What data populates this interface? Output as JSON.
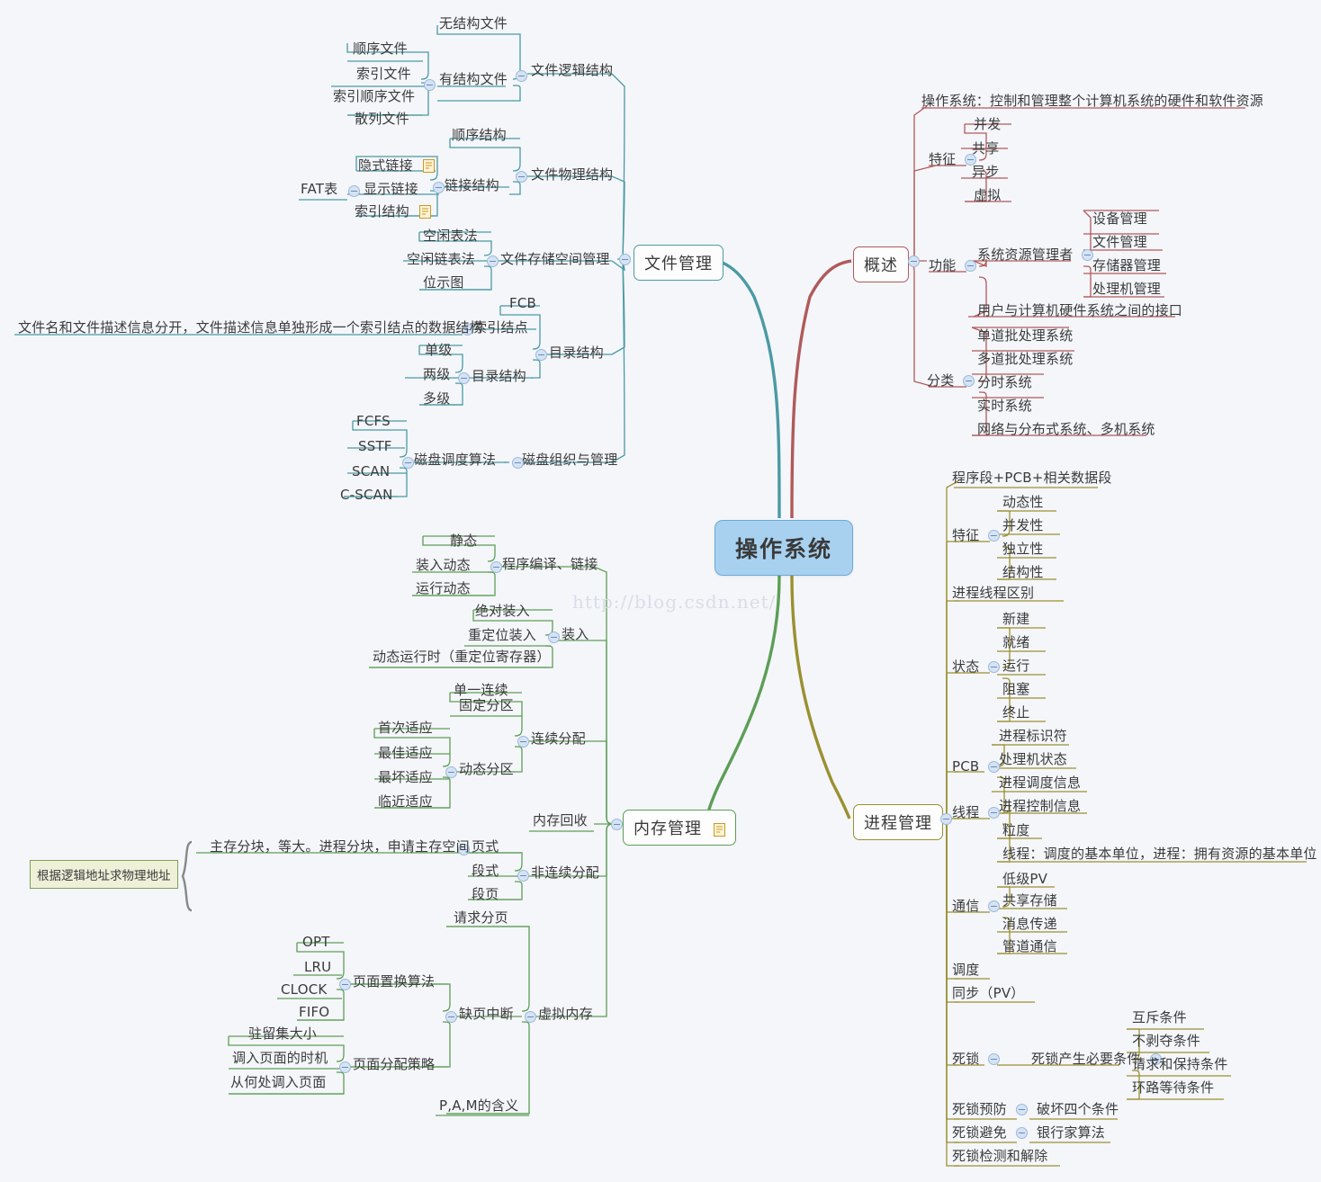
{
  "root": {
    "label": "操作系统"
  },
  "watermark": "http://blog.csdn.net/",
  "colors": {
    "file_branch": "#4a9aa3",
    "overview_branch": "#b05a5a",
    "memory_branch": "#5d9e56",
    "process_branch": "#9a9030",
    "root_fill": "#a8d1f0",
    "root_border": "#6fa8d4",
    "background": "#f4f6fa",
    "callout_fill": "#eef0d8",
    "callout_border": "#7fa05a"
  },
  "main_topics": {
    "file": "文件管理",
    "overview": "概述",
    "memory": "内存管理",
    "process": "进程管理"
  },
  "overview": {
    "definition": "操作系统：控制和管理整个计算机系统的硬件和软件资源",
    "features_label": "特征",
    "features": [
      "并发",
      "共享",
      "异步",
      "虚拟"
    ],
    "functions_label": "功能",
    "resource_manager": "系统资源管理者",
    "resource_items": [
      "设备管理",
      "文件管理",
      "存储器管理",
      "处理机管理"
    ],
    "interface": "用户与计算机硬件系统之间的接口",
    "classification_label": "分类",
    "classification": [
      "单道批处理系统",
      "多道批处理系统",
      "分时系统",
      "实时系统",
      "网络与分布式系统、多机系统"
    ]
  },
  "file": {
    "logical_structure": "文件逻辑结构",
    "unstructured": "无结构文件",
    "structured": "有结构文件",
    "structured_items": [
      "顺序文件",
      "索引文件",
      "索引顺序文件",
      "散列文件"
    ],
    "physical_structure": "文件物理结构",
    "sequential_struct": "顺序结构",
    "link_struct": "链接结构",
    "link_items": [
      "隐式链接",
      "显示链接",
      "索引结构"
    ],
    "fat": "FAT表",
    "storage_mgmt": "文件存储空间管理",
    "storage_items": [
      "空闲表法",
      "空闲链表法",
      "位示图"
    ],
    "directory_structure": "目录结构",
    "fcb": "FCB",
    "index_node": "索引结点",
    "index_node_note": "文件名和文件描述信息分开，文件描述信息单独形成一个索引结点的数据结构",
    "dir_structure_sub": "目录结构",
    "dir_levels": [
      "单级",
      "两级",
      "多级"
    ],
    "disk_mgmt": "磁盘组织与管理",
    "disk_sched": "磁盘调度算法",
    "disk_algos": [
      "FCFS",
      "SSTF",
      "SCAN",
      "C-SCAN"
    ]
  },
  "memory": {
    "compile_link": "程序编译、链接",
    "compile_items": [
      "静态",
      "装入动态",
      "运行动态"
    ],
    "load": "装入",
    "load_items": [
      "绝对装入",
      "重定位装入",
      "动态运行时（重定位寄存器）"
    ],
    "contiguous": "连续分配",
    "single_contiguous": "单一连续",
    "fixed_partition": "固定分区",
    "dynamic_partition": "动态分区",
    "fit_algos": [
      "首次适应",
      "最佳适应",
      "最坏适应",
      "临近适应"
    ],
    "memory_reclaim": "内存回收",
    "non_contiguous": "非连续分配",
    "paging": "页式",
    "paging_note": "主存分块，等大。进程分块，申请主存空间",
    "segment": "段式",
    "segment_page": "段页",
    "callout": "根据逻辑地址求物理地址",
    "virtual_memory": "虚拟内存",
    "demand_paging": "请求分页",
    "page_fault": "缺页中断",
    "replacement_algo": "页面置换算法",
    "replacement_items": [
      "OPT",
      "LRU",
      "CLOCK",
      "FIFO"
    ],
    "alloc_policy": "页面分配策略",
    "alloc_items": [
      "驻留集大小",
      "调入页面的时机",
      "从何处调入页面"
    ],
    "pam": "P,A,M的含义"
  },
  "process": {
    "composition": "程序段+PCB+相关数据段",
    "features_label": "特征",
    "features": [
      "动态性",
      "并发性",
      "独立性",
      "结构性"
    ],
    "thread_diff": "进程线程区别",
    "state_label": "状态",
    "states": [
      "新建",
      "就绪",
      "运行",
      "阻塞",
      "终止"
    ],
    "pcb_label": "PCB",
    "pcb_items": [
      "进程标识符",
      "处理机状态",
      "进程调度信息",
      "进程控制信息"
    ],
    "thread_label": "线程",
    "thread_items": [
      "粒度",
      "线程：调度的基本单位，进程：拥有资源的基本单位"
    ],
    "comm_label": "通信",
    "comm_items": [
      "低级PV",
      "共享存储",
      "消息传递",
      "管道通信"
    ],
    "schedule": "调度",
    "sync": "同步（PV）",
    "deadlock": "死锁",
    "deadlock_cond_label": "死锁产生必要条件",
    "deadlock_conds": [
      "互斥条件",
      "不剥夺条件",
      "请求和保持条件",
      "环路等待条件"
    ],
    "prevention": "死锁预防",
    "prevention_sub": "破坏四个条件",
    "avoidance": "死锁避免",
    "avoidance_sub": "银行家算法",
    "detection": "死锁检测和解除"
  }
}
